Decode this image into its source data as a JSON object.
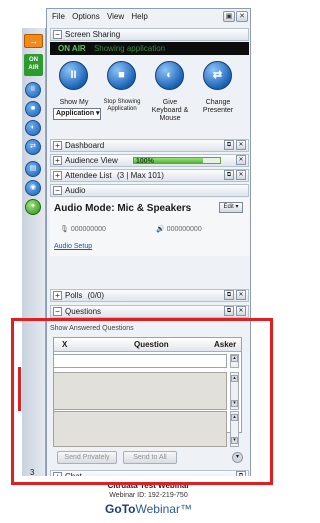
{
  "menu": {
    "items": [
      "File",
      "Options",
      "View",
      "Help"
    ],
    "window_btn": "▣"
  },
  "strip": {
    "arrow_label": "→",
    "onair_line1": "ON",
    "onair_line2": "AIR",
    "badge_number": "3"
  },
  "screen_sharing": {
    "title": "Screen Sharing",
    "onair_label": "ON AIR",
    "status": "Showing application",
    "show_my_label": "Show My",
    "app_dropdown": "Application ▾",
    "stop_label": "Stop Showing Application",
    "give_label": "Give Keyboard & Mouse",
    "change_label": "Change Presenter"
  },
  "sections": {
    "dashboard": "Dashboard",
    "audience_view": "Audience View",
    "audience_pct": "100%",
    "audience_fill": 0.8,
    "attendee_list": "Attendee List",
    "attendee_meta": "(3 | Max 101)",
    "audio": "Audio",
    "polls": "Polls",
    "polls_count": "(0/0)",
    "questions": "Questions",
    "chat": "Chat"
  },
  "audio": {
    "mode_label": "Audio Mode: Mic & Speakers",
    "edit_btn": "Edit ▾",
    "mic_level": "000000000",
    "speaker_level": "000000000",
    "setup_link": "Audio Setup"
  },
  "questions": {
    "show_answered": "Show Answered Questions",
    "col_x": "X",
    "col_question": "Question",
    "col_asker": "Asker",
    "send_private": "Send Privately",
    "send_all": "Send to All"
  },
  "footer": {
    "line1": "Citrdata Test Webinar",
    "line2": "Webinar ID: 192-219-750",
    "logo_goto": "GoTo",
    "logo_webinar": "Webinar"
  },
  "colors": {
    "onair_green": "#5cc95c",
    "highlight_red": "#e02020",
    "button_blue": "#1c63b8"
  }
}
